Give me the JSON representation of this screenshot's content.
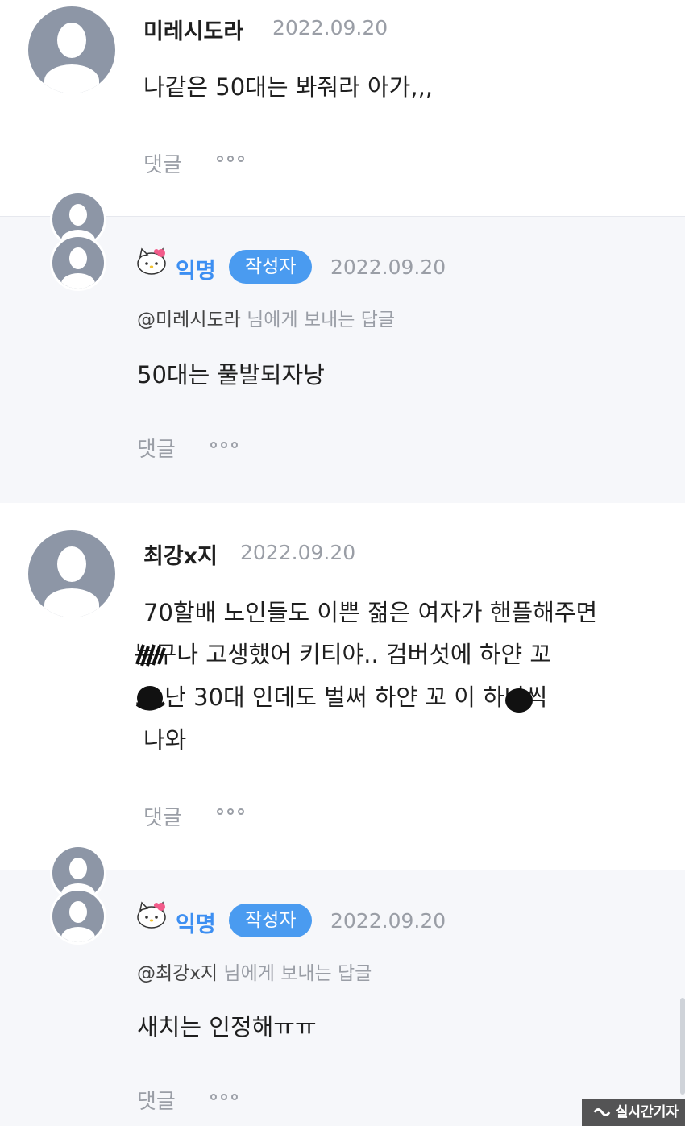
{
  "comments": [
    {
      "author": "미레시도라",
      "date": "2022.09.20",
      "lines": [
        "나같은 50대는 봐줘라 아가,,,"
      ],
      "reply_label": "댓글"
    },
    {
      "author": "익명",
      "badge": "작성자",
      "date": "2022.09.20",
      "mention_user": "@미레시도라",
      "mention_suffix": " 님에게 보내는 답글",
      "lines": [
        "50대는 풀발되자낭"
      ],
      "reply_label": "댓글"
    },
    {
      "author": "최강x지",
      "date": "2022.09.20",
      "lines": [
        "70할배 노인들도 이쁜 젊은 여자가 핸플해주면",
        "  는구나 고생했어 키티야.. 검버섯에 하얀 꼬",
        "  … 난 30대 인데도 벌써 하얀 꼬  이 하나씩",
        "나와"
      ],
      "reply_label": "댓글"
    },
    {
      "author": "익명",
      "badge": "작성자",
      "date": "2022.09.20",
      "mention_user": "@최강x지",
      "mention_suffix": " 님에게 보내는 답글",
      "lines": [
        "새치는 인정해ㅠㅠ"
      ],
      "reply_label": "댓글"
    }
  ],
  "watermark": "실시간기자",
  "colors": {
    "accent": "#3d8ff2",
    "badge": "#4a9bf0",
    "reply_bg": "#f6f7fa",
    "muted": "#9a9ea6"
  }
}
